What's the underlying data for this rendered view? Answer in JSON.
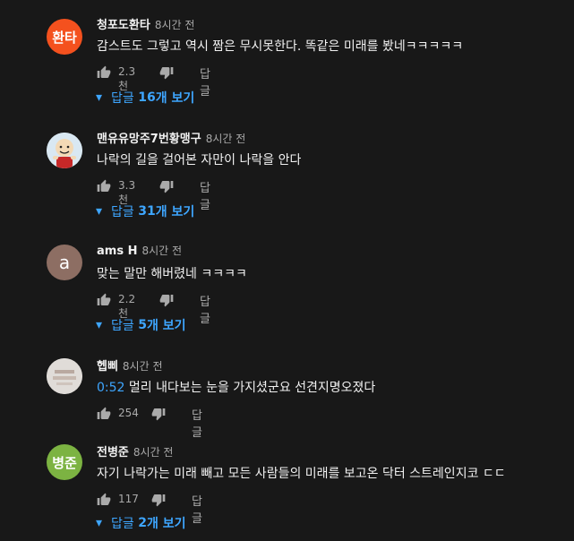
{
  "comments": [
    {
      "avatar_text": "환타",
      "avatar_color": "#f4511e",
      "author": "청포도환타",
      "time": "8시간 전",
      "timestamp": "",
      "text": "감스트도 그렇고 역시 짬은 무시못한다. 똑같은 미래를 봤네ㅋㅋㅋㅋㅋ",
      "likes": "2.3천",
      "reply_label": "답글",
      "replies_prefix": "답글 ",
      "replies_count": "16",
      "replies_suffix": "개 보기"
    },
    {
      "avatar_text": "",
      "avatar_color": "#7aa7c7",
      "author": "맨유유망주7번황맹구",
      "time": "8시간 전",
      "timestamp": "",
      "text": "나락의 길을 걸어본 자만이 나락을 안다",
      "likes": "3.3천",
      "reply_label": "답글",
      "replies_prefix": "답글 ",
      "replies_count": "31",
      "replies_suffix": "개 보기"
    },
    {
      "avatar_text": "a",
      "avatar_color": "#8d6e63",
      "author": "ams H",
      "time": "8시간 전",
      "timestamp": "",
      "text": "맞는 말만 해버렸네 ㅋㅋㅋㅋ",
      "likes": "2.2천",
      "reply_label": "답글",
      "replies_prefix": "답글 ",
      "replies_count": "5",
      "replies_suffix": "개 보기"
    },
    {
      "avatar_text": "",
      "avatar_color": "#d9d9d9",
      "author": "헵삐",
      "time": "8시간 전",
      "timestamp": "0:52",
      "text": " 멀리 내다보는 눈을 가지셨군요 선견지명오졌다",
      "likes": "254",
      "reply_label": "답글",
      "replies_prefix": "",
      "replies_count": "",
      "replies_suffix": ""
    },
    {
      "avatar_text": "병준",
      "avatar_color": "#7cb342",
      "author": "전병준",
      "time": "8시간 전",
      "timestamp": "",
      "text": "자기 나락가는 미래 빼고 모든 사람들의 미래를 보고온 닥터 스트레인지코 ㄷㄷ",
      "likes": "117",
      "reply_label": "답글",
      "replies_prefix": "답글 ",
      "replies_count": "2",
      "replies_suffix": "개 보기"
    }
  ]
}
